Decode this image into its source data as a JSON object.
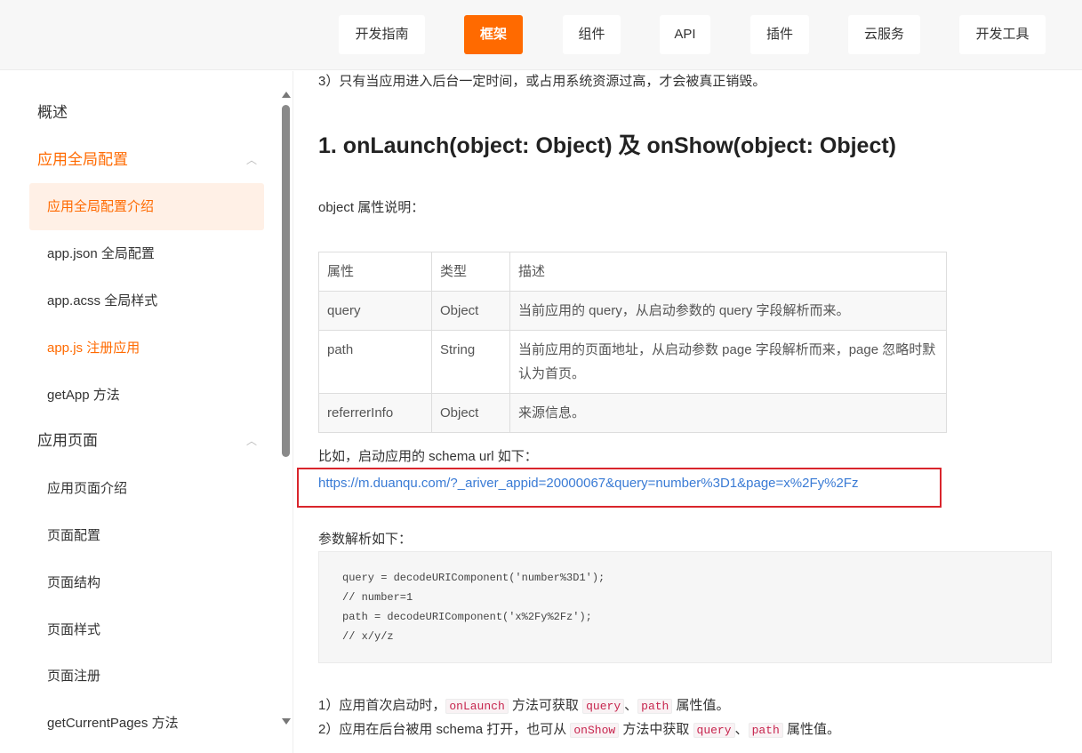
{
  "nav": {
    "tabs": [
      {
        "label": "开发指南"
      },
      {
        "label": "框架"
      },
      {
        "label": "组件"
      },
      {
        "label": "API"
      },
      {
        "label": "插件"
      },
      {
        "label": "云服务"
      },
      {
        "label": "开发工具"
      }
    ],
    "active_index": 1
  },
  "sidebar": {
    "overview": "概述",
    "group1": "应用全局配置",
    "items1": [
      "应用全局配置介绍",
      "app.json 全局配置",
      "app.acss 全局样式",
      "app.js 注册应用",
      "getApp 方法"
    ],
    "group2": "应用页面",
    "items2": [
      "应用页面介绍",
      "页面配置",
      "页面结构",
      "页面样式",
      "页面注册",
      "getCurrentPages 方法"
    ]
  },
  "content": {
    "intro_line": "3）只有当应用进入后台一定时间，或占用系统资源过高，才会被真正销毁。",
    "heading": "1. onLaunch(object: Object) 及 onShow(object: Object)",
    "props_caption": "object 属性说明：",
    "table": {
      "headers": [
        "属性",
        "类型",
        "描述"
      ],
      "rows": [
        [
          "query",
          "Object",
          "当前应用的 query，从启动参数的 query 字段解析而来。"
        ],
        [
          "path",
          "String",
          "当前应用的页面地址，从启动参数 page 字段解析而来，page 忽略时默认为首页。"
        ],
        [
          "referrerInfo",
          "Object",
          "来源信息。"
        ]
      ]
    },
    "example_caption": "比如，启动应用的 schema url 如下：",
    "url": "https://m.duanqu.com/?_ariver_appid=20000067&query=number%3D1&page=x%2Fy%2Fz",
    "parse_caption": "参数解析如下：",
    "code_lines": [
      "query = decodeURIComponent('number%3D1');",
      "// number=1",
      "path = decodeURIComponent('x%2Fy%2Fz');",
      "// x/y/z"
    ],
    "note1": {
      "pre": "1）应用首次启动时，",
      "code1": "onLaunch",
      "mid": " 方法可获取 ",
      "code2": "query",
      "sep": "、",
      "code3": "path",
      "post": " 属性值。"
    },
    "note2": {
      "pre": "2）应用在后台被用 schema 打开，也可从 ",
      "code1": "onShow",
      "mid": " 方法中获取 ",
      "code2": "query",
      "sep": "、",
      "code3": "path",
      "post": " 属性值。"
    }
  },
  "colors": {
    "accent": "#ff6a00",
    "link": "#3a7bd5",
    "highlight_border": "#d9252c"
  }
}
